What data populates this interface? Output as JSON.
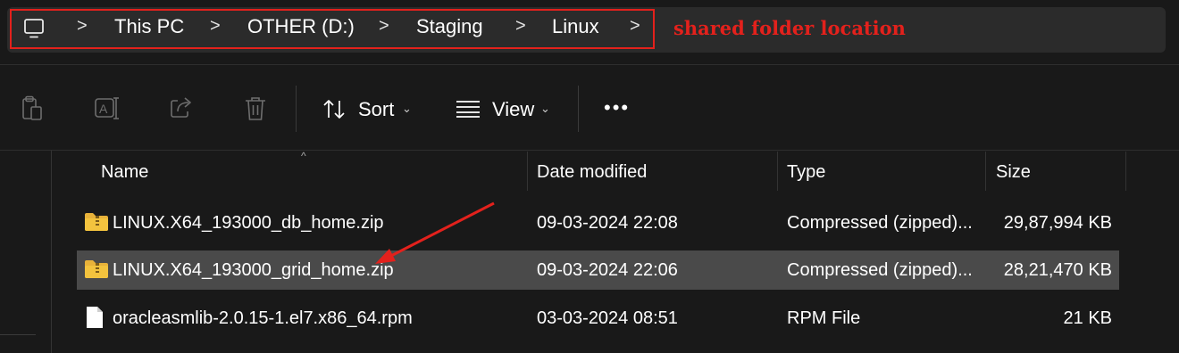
{
  "address_bar": {
    "crumbs": [
      "This PC",
      "OTHER (D:)",
      "Staging",
      "Linux"
    ],
    "separator": ">",
    "annotation": "shared folder location"
  },
  "toolbar": {
    "sort_label": "Sort",
    "view_label": "View",
    "more_label": "•••",
    "dropdown_chevron": "⌄"
  },
  "columns": {
    "name": "Name",
    "date": "Date modified",
    "type": "Type",
    "size": "Size"
  },
  "files": [
    {
      "name": "LINUX.X64_193000_db_home.zip",
      "date": "09-03-2024 22:08",
      "type": "Compressed (zipped)...",
      "size": "29,87,994 KB",
      "icon": "zip-folder-icon"
    },
    {
      "name": "LINUX.X64_193000_grid_home.zip",
      "date": "09-03-2024 22:06",
      "type": "Compressed (zipped)...",
      "size": "28,21,470 KB",
      "icon": "zip-folder-icon"
    },
    {
      "name": "oracleasmlib-2.0.15-1.el7.x86_64.rpm",
      "date": "03-03-2024 08:51",
      "type": "RPM File",
      "size": "21 KB",
      "icon": "file-icon"
    }
  ],
  "colors": {
    "background": "#191919",
    "address_pill": "#2b2b2b",
    "selected_row": "#4a4a4a",
    "annotation_red": "#e3211c",
    "folder_yellow": "#f3c33e"
  }
}
